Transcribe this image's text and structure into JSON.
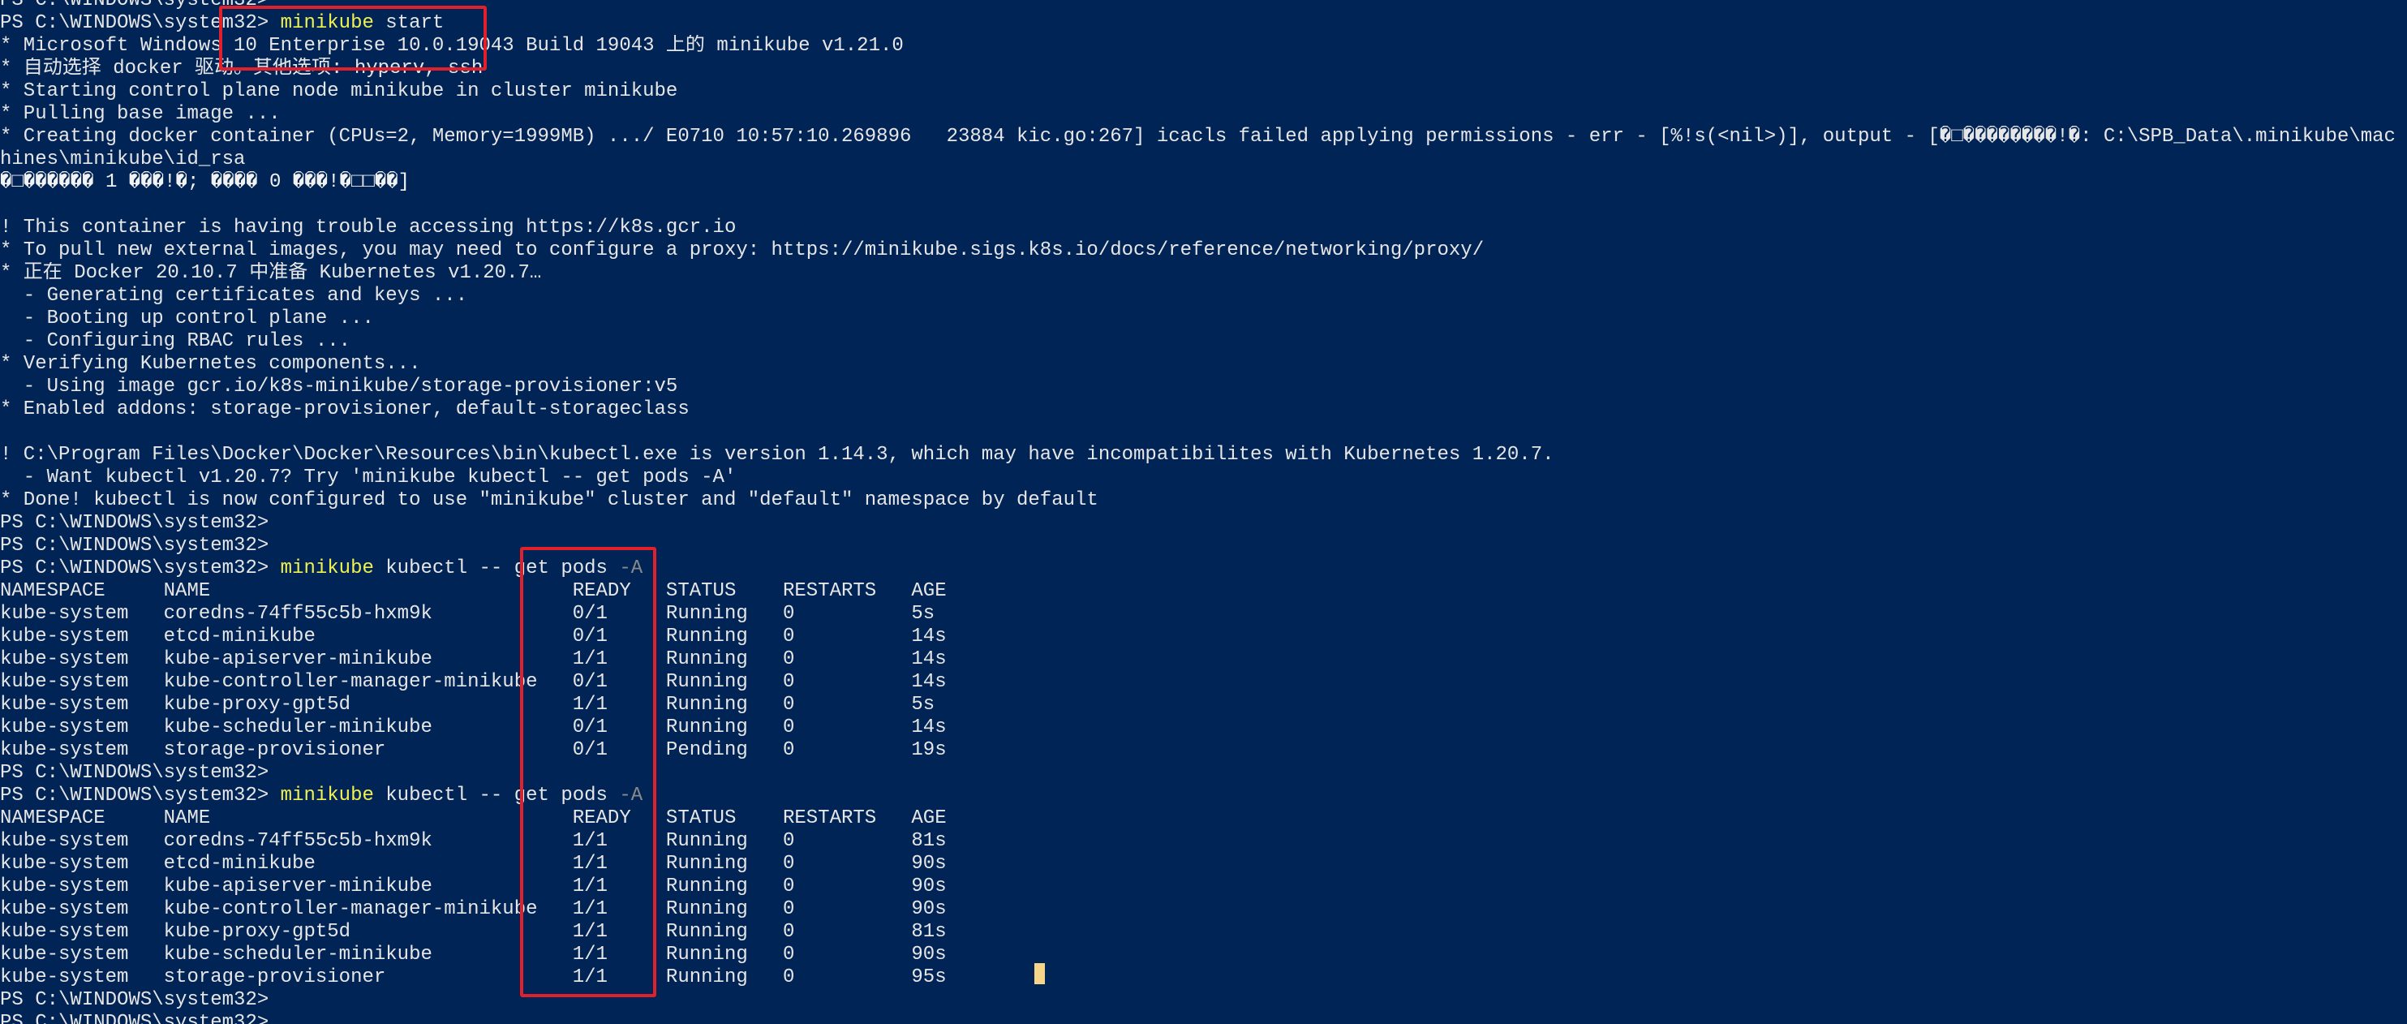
{
  "terminal": {
    "app": "Windows PowerShell",
    "lines": [
      [
        {
          "t": "PS C:\\WINDOWS\\system32>",
          "s": "plain"
        }
      ],
      [
        {
          "t": "PS C:\\WINDOWS\\system32> ",
          "s": "plain"
        },
        {
          "t": "minikube",
          "s": "cmd"
        },
        {
          "t": " start",
          "s": "plain"
        }
      ],
      [
        {
          "t": "* Microsoft Windows 10 Enterprise 10.0.19043 Build 19043 上的 minikube v1.21.0",
          "s": "plain"
        }
      ],
      [
        {
          "t": "* 自动选择 docker 驱动。其他选项: hyperv, ssh",
          "s": "plain"
        }
      ],
      [
        {
          "t": "* Starting control plane node minikube in cluster minikube",
          "s": "plain"
        }
      ],
      [
        {
          "t": "* Pulling base image ...",
          "s": "plain"
        }
      ],
      [
        {
          "t": "* Creating docker container (CPUs=2, Memory=1999MB) .../ E0710 10:57:10.269896   23884 kic.go:267] icacls failed applying permissions - err - [%!s(<nil>)], output - [�□��������!�: C:\\SPB_Data\\.minikube\\mac",
          "s": "plain"
        }
      ],
      [
        {
          "t": "hines\\minikube\\id_rsa",
          "s": "plain"
        }
      ],
      [
        {
          "t": "�□������ 1 ���!�; ���� 0 ���!�□□��]",
          "s": "garbled"
        }
      ],
      [
        {
          "t": "",
          "s": "plain"
        }
      ],
      [
        {
          "t": "! This container is having trouble accessing https://k8s.gcr.io",
          "s": "plain"
        }
      ],
      [
        {
          "t": "* To pull new external images, you may need to configure a proxy: https://minikube.sigs.k8s.io/docs/reference/networking/proxy/",
          "s": "plain"
        }
      ],
      [
        {
          "t": "* 正在 Docker 20.10.7 中准备 Kubernetes v1.20.7…",
          "s": "plain"
        }
      ],
      [
        {
          "t": "  - Generating certificates and keys ...",
          "s": "plain"
        }
      ],
      [
        {
          "t": "  - Booting up control plane ...",
          "s": "plain"
        }
      ],
      [
        {
          "t": "  - Configuring RBAC rules ...",
          "s": "plain"
        }
      ],
      [
        {
          "t": "* Verifying Kubernetes components...",
          "s": "plain"
        }
      ],
      [
        {
          "t": "  - Using image gcr.io/k8s-minikube/storage-provisioner:v5",
          "s": "plain"
        }
      ],
      [
        {
          "t": "* Enabled addons: storage-provisioner, default-storageclass",
          "s": "plain"
        }
      ],
      [
        {
          "t": "",
          "s": "plain"
        }
      ],
      [
        {
          "t": "! C:\\Program Files\\Docker\\Docker\\Resources\\bin\\kubectl.exe is version 1.14.3, which may have incompatibilites with Kubernetes 1.20.7.",
          "s": "plain"
        }
      ],
      [
        {
          "t": "  - Want kubectl v1.20.7? Try 'minikube kubectl -- get pods -A'",
          "s": "plain"
        }
      ],
      [
        {
          "t": "* Done! kubectl is now configured to use \"minikube\" cluster and \"default\" namespace by default",
          "s": "plain"
        }
      ],
      [
        {
          "t": "PS C:\\WINDOWS\\system32>",
          "s": "plain"
        }
      ],
      [
        {
          "t": "PS C:\\WINDOWS\\system32>",
          "s": "plain"
        }
      ],
      [
        {
          "t": "PS C:\\WINDOWS\\system32> ",
          "s": "plain"
        },
        {
          "t": "minikube",
          "s": "cmd"
        },
        {
          "t": " kubectl -- get pods ",
          "s": "plain"
        },
        {
          "t": "-A",
          "s": "dim"
        }
      ],
      [
        {
          "t": "NAMESPACE     NAME                               READY   STATUS    RESTARTS   AGE",
          "s": "plain"
        }
      ],
      [
        {
          "t": "kube-system   coredns-74ff55c5b-hxm9k            0/1     Running   0          5s",
          "s": "plain"
        }
      ],
      [
        {
          "t": "kube-system   etcd-minikube                      0/1     Running   0          14s",
          "s": "plain"
        }
      ],
      [
        {
          "t": "kube-system   kube-apiserver-minikube            1/1     Running   0          14s",
          "s": "plain"
        }
      ],
      [
        {
          "t": "kube-system   kube-controller-manager-minikube   0/1     Running   0          14s",
          "s": "plain"
        }
      ],
      [
        {
          "t": "kube-system   kube-proxy-gpt5d                   1/1     Running   0          5s",
          "s": "plain"
        }
      ],
      [
        {
          "t": "kube-system   kube-scheduler-minikube            0/1     Running   0          14s",
          "s": "plain"
        }
      ],
      [
        {
          "t": "kube-system   storage-provisioner                0/1     Pending   0          19s",
          "s": "plain"
        }
      ],
      [
        {
          "t": "PS C:\\WINDOWS\\system32>",
          "s": "plain"
        }
      ],
      [
        {
          "t": "PS C:\\WINDOWS\\system32> ",
          "s": "plain"
        },
        {
          "t": "minikube",
          "s": "cmd"
        },
        {
          "t": " kubectl -- get pods ",
          "s": "plain"
        },
        {
          "t": "-A",
          "s": "dim"
        }
      ],
      [
        {
          "t": "NAMESPACE     NAME                               READY   STATUS    RESTARTS   AGE",
          "s": "plain"
        }
      ],
      [
        {
          "t": "kube-system   coredns-74ff55c5b-hxm9k            1/1     Running   0          81s",
          "s": "plain"
        }
      ],
      [
        {
          "t": "kube-system   etcd-minikube                      1/1     Running   0          90s",
          "s": "plain"
        }
      ],
      [
        {
          "t": "kube-system   kube-apiserver-minikube            1/1     Running   0          90s",
          "s": "plain"
        }
      ],
      [
        {
          "t": "kube-system   kube-controller-manager-minikube   1/1     Running   0          90s",
          "s": "plain"
        }
      ],
      [
        {
          "t": "kube-system   kube-proxy-gpt5d                   1/1     Running   0          81s",
          "s": "plain"
        }
      ],
      [
        {
          "t": "kube-system   kube-scheduler-minikube            1/1     Running   0          90s",
          "s": "plain"
        }
      ],
      [
        {
          "t": "kube-system   storage-provisioner                1/1     Running   0          95s",
          "s": "plain"
        }
      ],
      [
        {
          "t": "PS C:\\WINDOWS\\system32>",
          "s": "plain"
        }
      ],
      [
        {
          "t": "PS C:\\WINDOWS\\system32>",
          "s": "plain"
        }
      ]
    ]
  },
  "colors": {
    "background": "#012456",
    "text": "#e6e6e6",
    "command": "#f0f050",
    "parameter": "#8a8a8a",
    "annotation_box": "#e0202a",
    "cursor": "#f5d58a"
  }
}
